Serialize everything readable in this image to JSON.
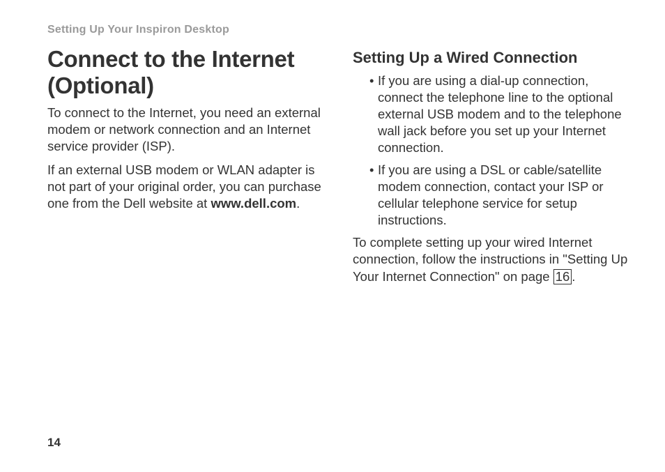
{
  "header": "Setting Up Your Inspiron Desktop",
  "left": {
    "title": "Connect to the Internet (Optional)",
    "p1": "To connect to the Internet, you need an external modem or network connection and an Internet service provider (ISP).",
    "p2_a": "If an external USB modem or WLAN adapter is not part of your original order, you can purchase one from the Dell website at ",
    "p2_bold": "www.dell.com",
    "p2_b": "."
  },
  "right": {
    "subtitle": "Setting Up a Wired Connection",
    "bullets": [
      "If you are using a dial-up connection, connect the telephone line to the optional external USB modem and to the telephone wall jack before you set up your Internet connection.",
      "If you are using a DSL or cable/satellite modem connection, contact your ISP or cellular telephone service for setup instructions."
    ],
    "p3_a": "To complete setting up your wired Internet connection, follow the instructions in \"Setting Up Your Internet Connection\" on page ",
    "p3_ref": "16",
    "p3_b": "."
  },
  "page_number": "14"
}
